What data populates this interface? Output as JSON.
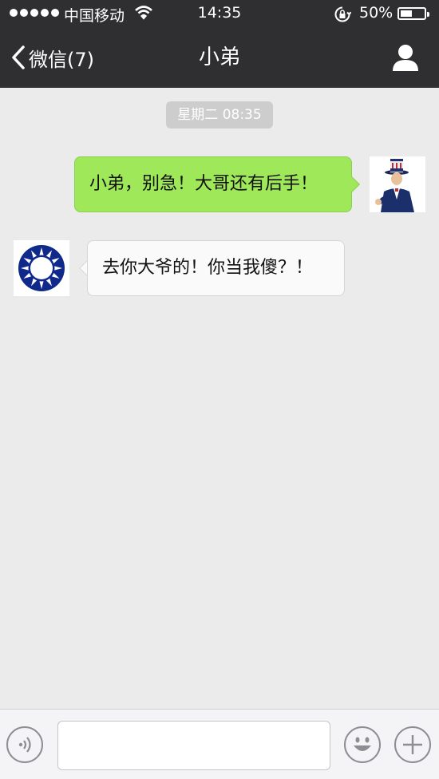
{
  "status_bar": {
    "carrier": "中国移动",
    "time": "14:35",
    "battery_percent": "50%",
    "battery_level": 0.5,
    "signal_dots": 5,
    "icons": [
      "signal-dots-icon",
      "wifi-icon",
      "rotation-lock-icon",
      "battery-icon"
    ]
  },
  "nav": {
    "back_label": "微信(7)",
    "title": "小弟",
    "right_icon": "person-icon"
  },
  "chat": {
    "timestamp": "星期二 08:35",
    "messages": [
      {
        "direction": "outgoing",
        "text": "小弟，别急！大哥还有后手！",
        "avatar": "uncle-sam-avatar"
      },
      {
        "direction": "incoming",
        "text": "去你大爷的！你当我傻？！",
        "avatar": "blue-sky-white-sun-avatar"
      }
    ]
  },
  "input_bar": {
    "voice_icon": "voice-icon",
    "input_value": "",
    "emoji_icon": "emoji-icon",
    "more_icon": "plus-icon"
  },
  "colors": {
    "bar_bg": "#2f2f31",
    "chat_bg": "#ebebeb",
    "outgoing_bubble": "#9ee85a",
    "incoming_bubble": "#fafafa",
    "timestamp_bg": "#cdcdcd"
  }
}
